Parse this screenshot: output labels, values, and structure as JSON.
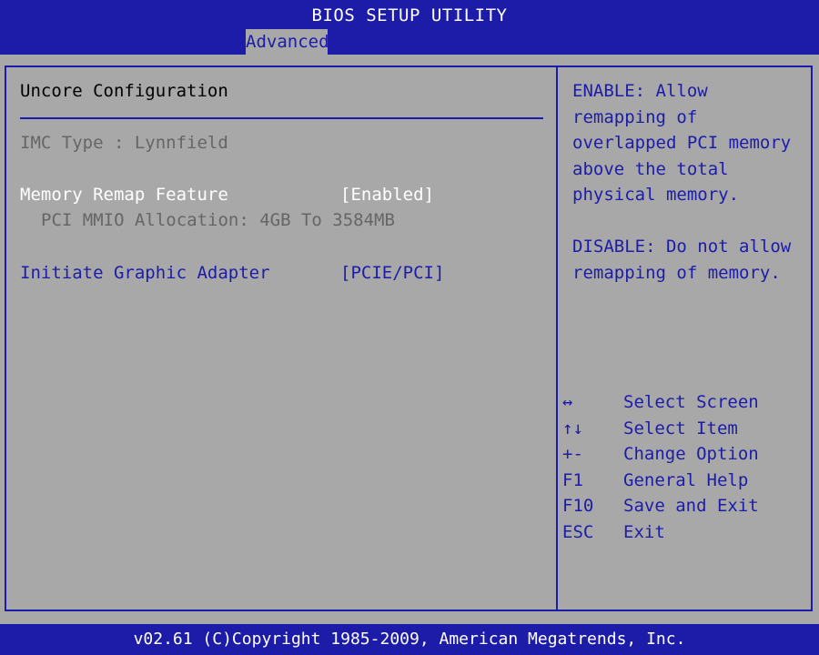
{
  "window": {
    "title": "BIOS SETUP UTILITY"
  },
  "tabs": [
    {
      "label": "Advanced",
      "active": true
    }
  ],
  "section": {
    "title": "Uncore Configuration"
  },
  "items": {
    "imc_type": {
      "label": "IMC Type : Lynnfield"
    },
    "memory_remap": {
      "label": "Memory Remap Feature",
      "value": "[Enabled]"
    },
    "pci_mmio": {
      "label": "PCI MMIO Allocation: 4GB To 3584MB"
    },
    "graphic_adapter": {
      "label": "Initiate Graphic Adapter",
      "value": "[PCIE/PCI]"
    }
  },
  "help": {
    "lines": [
      "ENABLE: Allow",
      "remapping of",
      "overlapped PCI memory",
      "above the total",
      "physical memory.",
      "DISABLE: Do not allow",
      "remapping of memory."
    ]
  },
  "keys": [
    {
      "key": "↔",
      "desc": "Select Screen"
    },
    {
      "key": "↑↓",
      "desc": "Select Item"
    },
    {
      "key": "+-",
      "desc": "Change Option"
    },
    {
      "key": "F1",
      "desc": "General Help"
    },
    {
      "key": "F10",
      "desc": "Save and Exit"
    },
    {
      "key": "ESC",
      "desc": "Exit"
    }
  ],
  "footer": {
    "text": "v02.61 (C)Copyright 1985-2009, American Megatrends, Inc."
  },
  "colors": {
    "bios_blue": "#1c1ca8",
    "panel_gray": "#a8a8a8",
    "highlight": "#ffffff",
    "disabled": "#666666"
  }
}
